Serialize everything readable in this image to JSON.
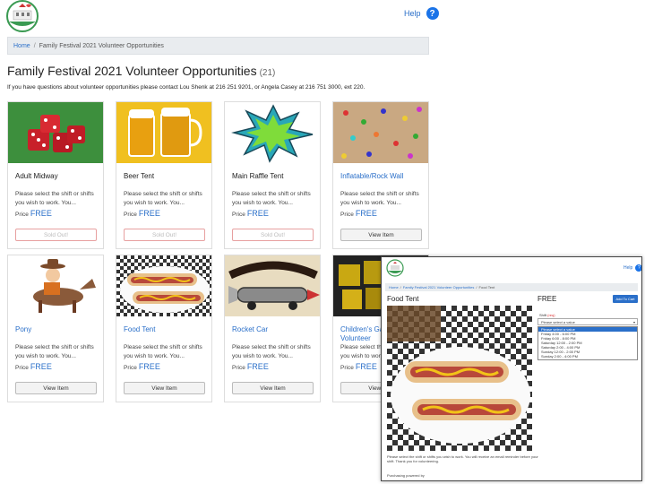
{
  "header": {
    "help_label": "Help",
    "help_glyph": "?"
  },
  "breadcrumb": {
    "home": "Home",
    "separator": "/",
    "current": "Family Festival 2021 Volunteer Opportunities"
  },
  "page": {
    "title": "Family Festival 2021 Volunteer Opportunities",
    "count": "(21)",
    "note": "If you have questions about volunteer opportunities please contact Lou Shenk at 216 251 9201, or Angela Casey at 216 751 3000, ext 220."
  },
  "cards": [
    {
      "name": "Adult Midway",
      "desc": "Please select the shift or shifts you wish to work. You...",
      "price_label": "Price",
      "price": "FREE",
      "button": "Sold Out!",
      "sold": true,
      "image": "dice-image"
    },
    {
      "name": "Beer Tent",
      "desc": "Please select the shift or shifts you wish to work. You...",
      "price_label": "Price",
      "price": "FREE",
      "button": "Sold Out!",
      "sold": true,
      "image": "beer-image"
    },
    {
      "name": "Main Raffle Tent",
      "desc": "Please select the shift or shifts you wish to work. You...",
      "price_label": "Price",
      "price": "FREE",
      "button": "Sold Out!",
      "sold": true,
      "image": "raffle-image"
    },
    {
      "name": "Inflatable/Rock Wall",
      "desc": "Please select the shift or shifts you wish to work. You...",
      "price_label": "Price",
      "price": "FREE",
      "button": "View Item",
      "sold": false,
      "image": "rock-wall-image"
    },
    {
      "name": "Pony",
      "desc": "Please select the shift or shifts you wish to work. You...",
      "price_label": "Price",
      "price": "FREE",
      "button": "View Item",
      "sold": false,
      "image": "pony-image"
    },
    {
      "name": "Food Tent",
      "desc": "Please select the shift or shifts you wish to work. You...",
      "price_label": "Price",
      "price": "FREE",
      "button": "View Item",
      "sold": false,
      "image": "hotdog-image"
    },
    {
      "name": "Rocket Car",
      "desc": "Please select the shift or shifts you wish to work. You...",
      "price_label": "Price",
      "price": "FREE",
      "button": "View Item",
      "sold": false,
      "image": "rocket-image"
    },
    {
      "name": "Children's Games Adult Volunteer",
      "desc": "Please select the shift or shifts you wish to work. You...",
      "price_label": "Price",
      "price": "FREE",
      "button": "View Item",
      "sold": false,
      "image": "games-image"
    }
  ],
  "popup": {
    "help_label": "Help",
    "crumb_home": "Home",
    "crumb_mid": "Family Festival 2021 Volunteer Opportunities",
    "crumb_current": "Food Tent",
    "title": "Food Tent",
    "price": "FREE",
    "add_button": "Add To Cart",
    "shift_label": "Shift",
    "required_mark": "(req)",
    "select_placeholder": "Please select a value",
    "options": [
      "Please select a value",
      "Friday 4:00 - 6:00 PM",
      "Friday 6:00 - 8:00 PM",
      "Saturday 12:00 - 2:00 PM",
      "Saturday 2:00 - 4:00 PM",
      "Sunday 12:00 - 2:00 PM",
      "Sunday 2:00 - 4:00 PM"
    ],
    "description": "Please select the shift or shifts you wish to work. You will receive an email reminder before your shift. Thank you for volunteering.",
    "footer": "Purchasing powered by"
  },
  "colors": {
    "accent": "#2a6fc9",
    "sold_border": "#e7a0a0"
  }
}
